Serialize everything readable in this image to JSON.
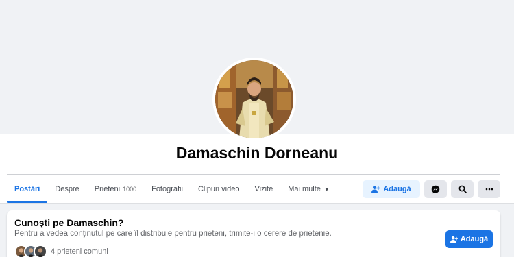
{
  "profile": {
    "name": "Damaschin Dorneanu"
  },
  "tabs": [
    {
      "label": "Postări",
      "active": true
    },
    {
      "label": "Despre"
    },
    {
      "label": "Prieteni",
      "count": "1000"
    },
    {
      "label": "Fotografii"
    },
    {
      "label": "Clipuri video"
    },
    {
      "label": "Vizite"
    },
    {
      "label": "Mai multe",
      "icon": "caret-down-icon"
    }
  ],
  "actions": {
    "add_label": "Adaugă",
    "add_icon": "add-friend-icon",
    "messenger_icon": "messenger-icon",
    "search_icon": "search-icon",
    "more_icon": "more-dots-icon"
  },
  "card": {
    "title": "Cunoşti pe Damaschin?",
    "subtitle": "Pentru a vedea conţinutul pe care îl distribuie pentru prieteni, trimite-i o cerere de prietenie.",
    "mutual_friends": "4 prieteni comuni",
    "add_label": "Adaugă"
  },
  "colors": {
    "accent": "#1b74e4",
    "page_bg": "#f0f2f5"
  }
}
